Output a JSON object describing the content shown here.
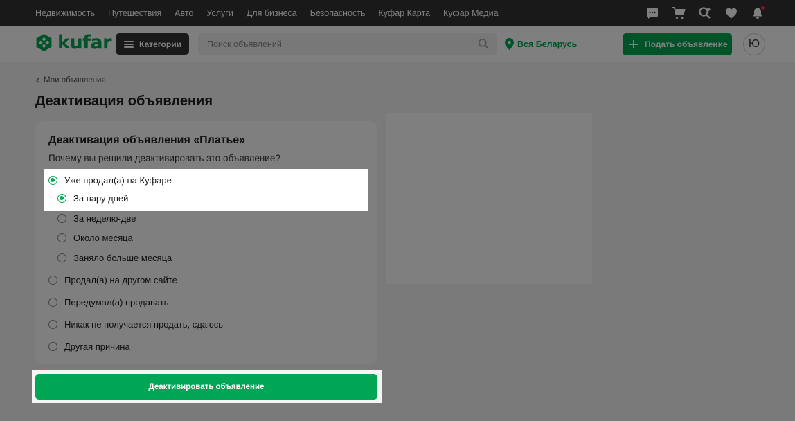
{
  "topbar": {
    "links": [
      "Недвижимость",
      "Путешествия",
      "Авто",
      "Услуги",
      "Для бизнеса",
      "Безопасность",
      "Куфар Карта",
      "Куфар Медиа"
    ],
    "icons": [
      "chat-icon",
      "cart-icon",
      "saved-search-icon",
      "heart-icon",
      "bell-icon"
    ]
  },
  "header": {
    "logo_text": "kufar",
    "categories_label": "Категории",
    "search_placeholder": "Поиск объявлений",
    "region_label": "Вся Беларусь",
    "post_button_label": "Подать объявление",
    "avatar_letter": "Ю"
  },
  "breadcrumb": {
    "label": "Мои объявления"
  },
  "page_title": "Деактивация объявления",
  "form": {
    "title": "Деактивация объявления «Платье»",
    "question": "Почему вы решили деактивировать это объявление?",
    "options": [
      {
        "label": "Уже продал(а) на Куфаре",
        "selected": true
      },
      {
        "label": "За пару дней",
        "selected": true
      },
      {
        "label": "За неделю-две",
        "selected": false
      },
      {
        "label": "Около месяца",
        "selected": false
      },
      {
        "label": "Заняло больше месяца",
        "selected": false
      },
      {
        "label": "Продал(а) на другом сайте",
        "selected": false
      },
      {
        "label": "Передумал(а) продавать",
        "selected": false
      },
      {
        "label": "Никак не получается продать, сдаюсь",
        "selected": false
      },
      {
        "label": "Другая причина",
        "selected": false
      }
    ],
    "submit_label": "Деактивировать объявление"
  },
  "colors": {
    "brand": "#00a653",
    "topbar": "#333333",
    "accent_dot": "#f2323f"
  }
}
